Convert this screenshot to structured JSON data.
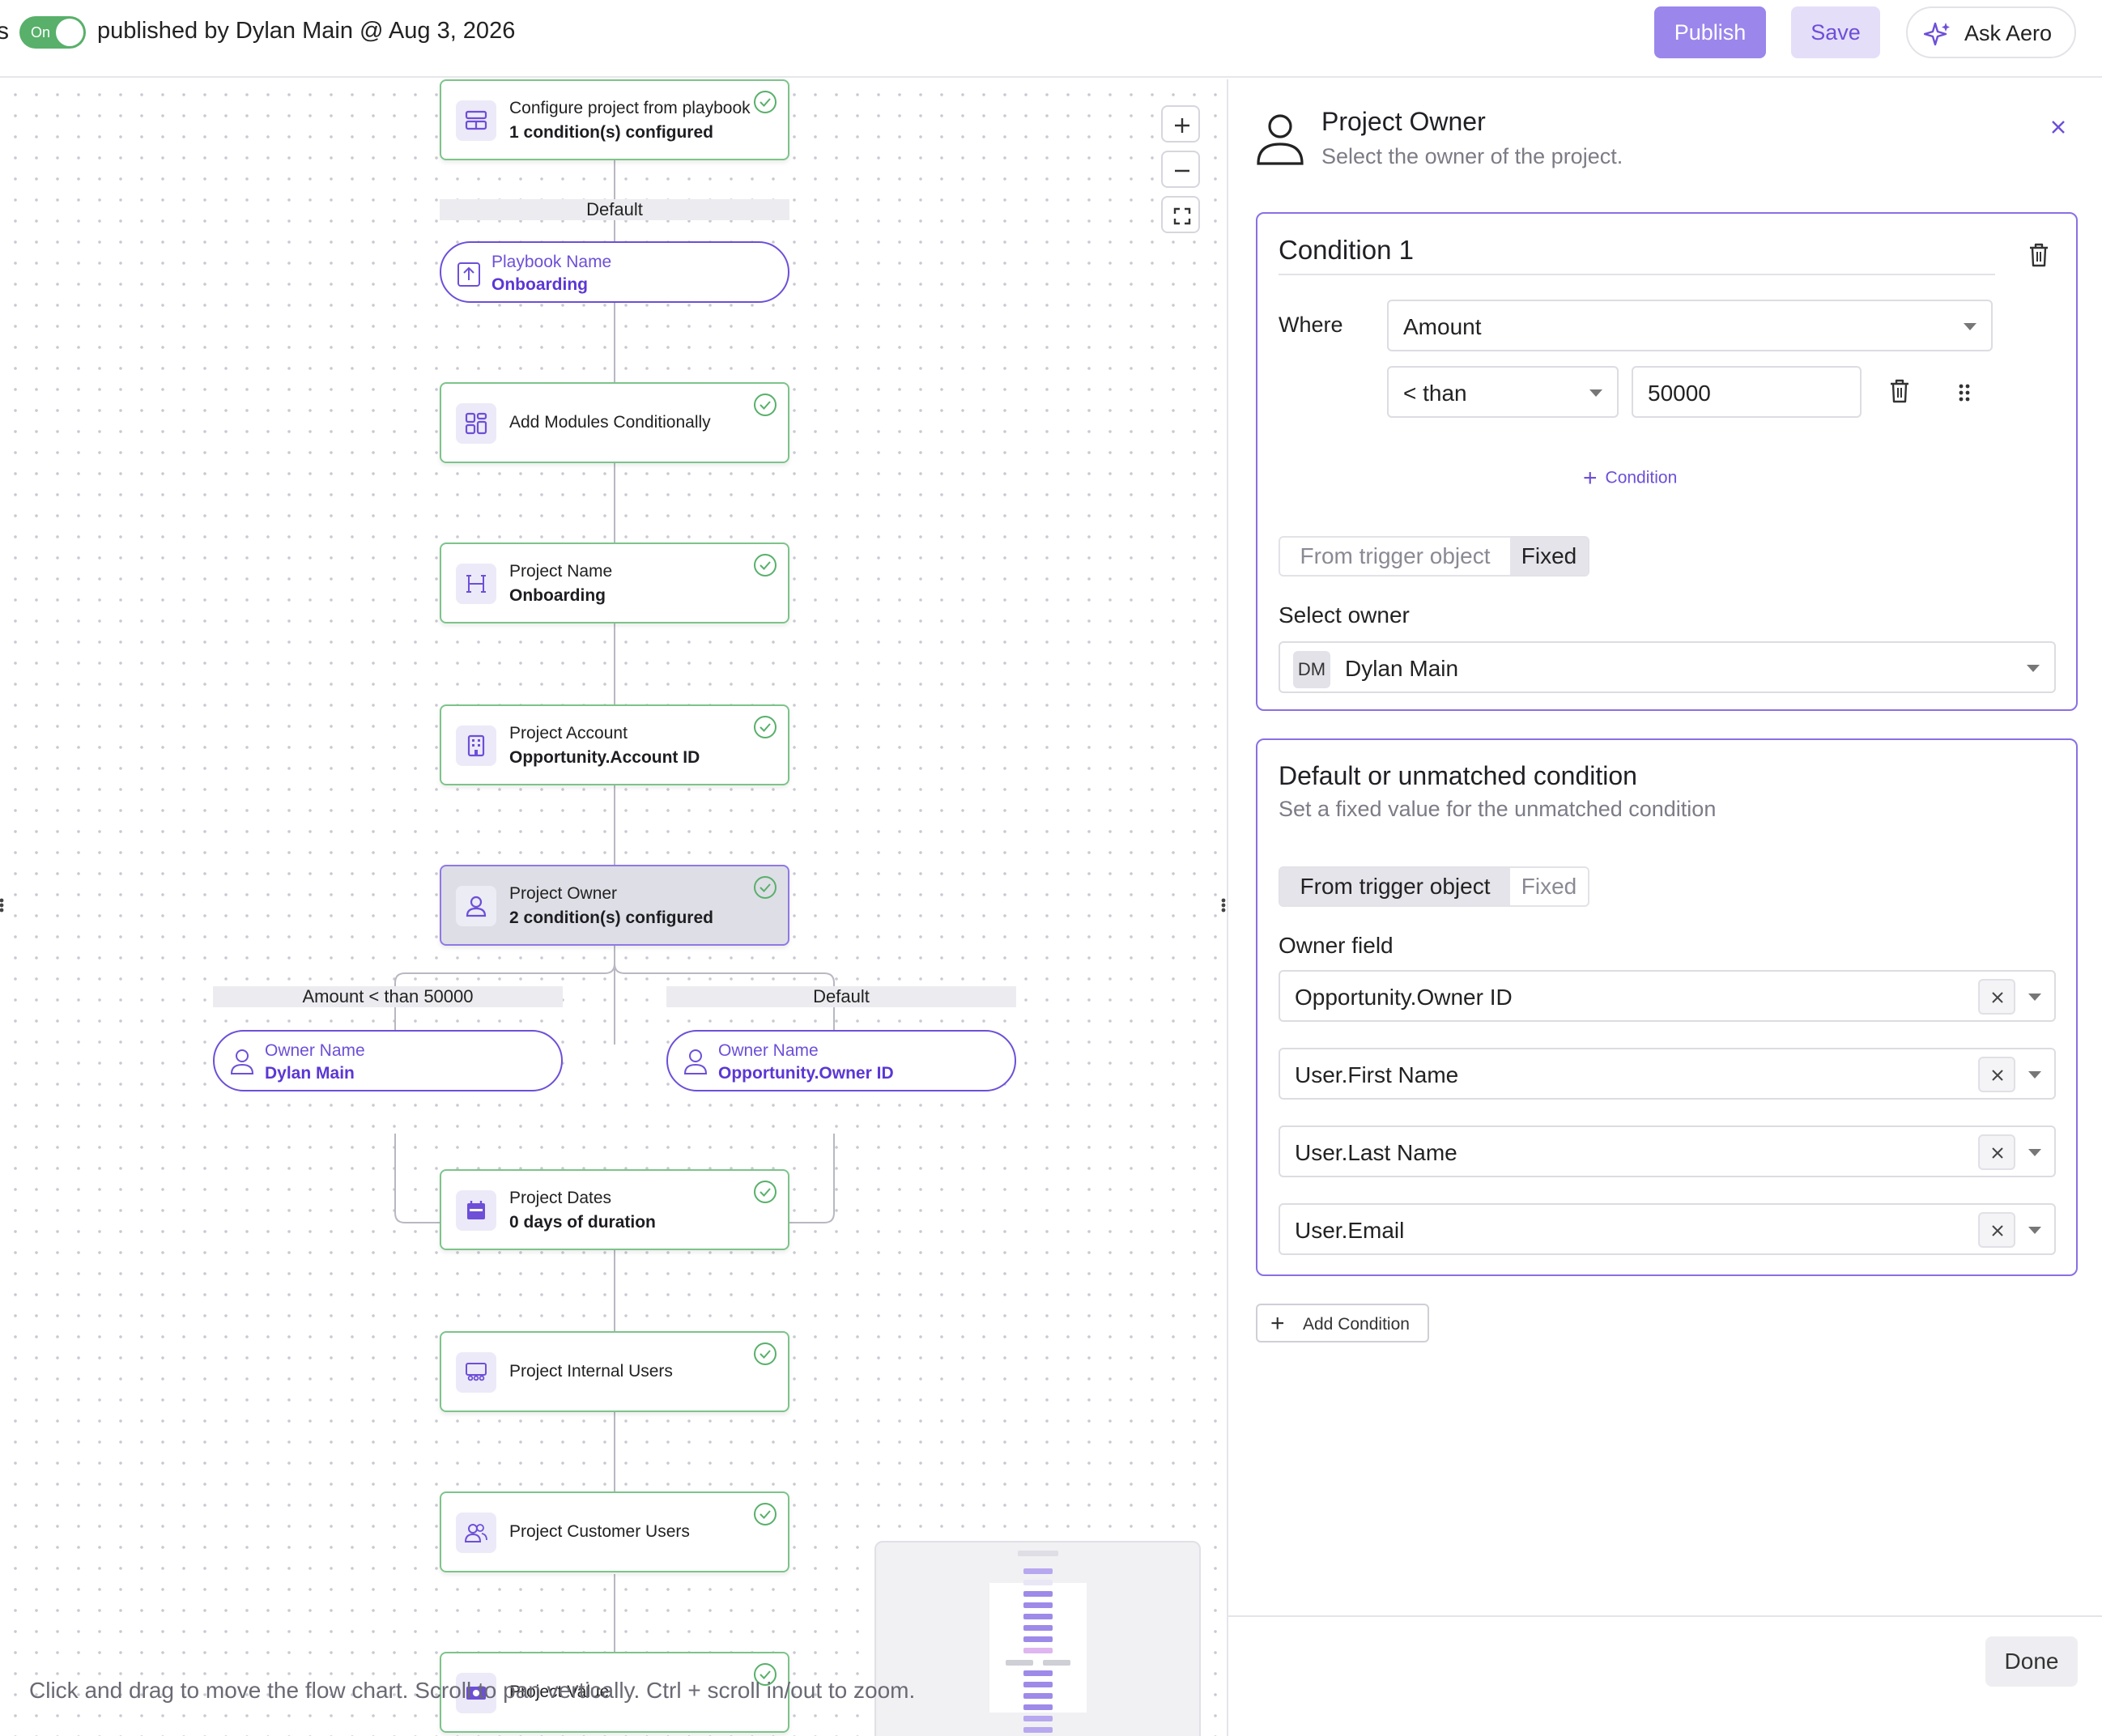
{
  "topbar": {
    "cut_label": "s",
    "toggle_label": "On",
    "published_by": "published by Dylan Main @ Aug 3, 2026",
    "publish_label": "Publish",
    "save_label": "Save",
    "ask_label": "Ask Aero"
  },
  "canvas": {
    "nodes": [
      {
        "line1": "Configure project from playbook",
        "line2": "1 condition(s) configured"
      },
      {
        "line1": "Add Modules Conditionally"
      },
      {
        "line1": "Project Name",
        "line2": "Onboarding"
      },
      {
        "line1": "Project Account",
        "line2": "Opportunity.Account ID"
      },
      {
        "line1": "Project Owner",
        "line2": "2 condition(s) configured"
      },
      {
        "line1": "Project Dates",
        "line2": "0 days of duration"
      },
      {
        "line1": "Project Internal Users"
      },
      {
        "line1": "Project Customer Users"
      },
      {
        "line1": "Project Value"
      }
    ],
    "branch_default_1": "Default",
    "playbook_pill": {
      "label": "Playbook Name",
      "value": "Onboarding"
    },
    "branch_amount": "Amount < than 50000",
    "branch_default_2": "Default",
    "owner_pill_1": {
      "label": "Owner Name",
      "value": "Dylan Main"
    },
    "owner_pill_2": {
      "label": "Owner Name",
      "value": "Opportunity.Owner ID"
    },
    "hint": "Click and drag to move the flow chart. Scroll to pan vertically. Ctrl + scroll in/out to zoom."
  },
  "panel": {
    "title": "Project Owner",
    "subtitle": "Select the owner of the project.",
    "condition1": {
      "title": "Condition 1",
      "where_label": "Where",
      "field_value": "Amount",
      "operator_value": "< than",
      "amount_value": "50000",
      "add_condition_label": "Condition",
      "seg_trigger": "From trigger object",
      "seg_fixed": "Fixed",
      "select_owner_label": "Select owner",
      "owner_initials": "DM",
      "owner_name": "Dylan Main"
    },
    "default_card": {
      "title": "Default or unmatched condition",
      "subtitle": "Set a fixed value for the unmatched condition",
      "seg_trigger": "From trigger object",
      "seg_fixed": "Fixed",
      "owner_field_label": "Owner field",
      "fields": [
        "Opportunity.Owner ID",
        "User.First Name",
        "User.Last Name",
        "User.Email"
      ]
    },
    "add_condition_button": "Add Condition",
    "done_label": "Done"
  },
  "colors": {
    "accent": "#6d4fd8",
    "accent_light": "#9b86ec",
    "success": "#58b06a",
    "node_border": "#7cc48a"
  }
}
